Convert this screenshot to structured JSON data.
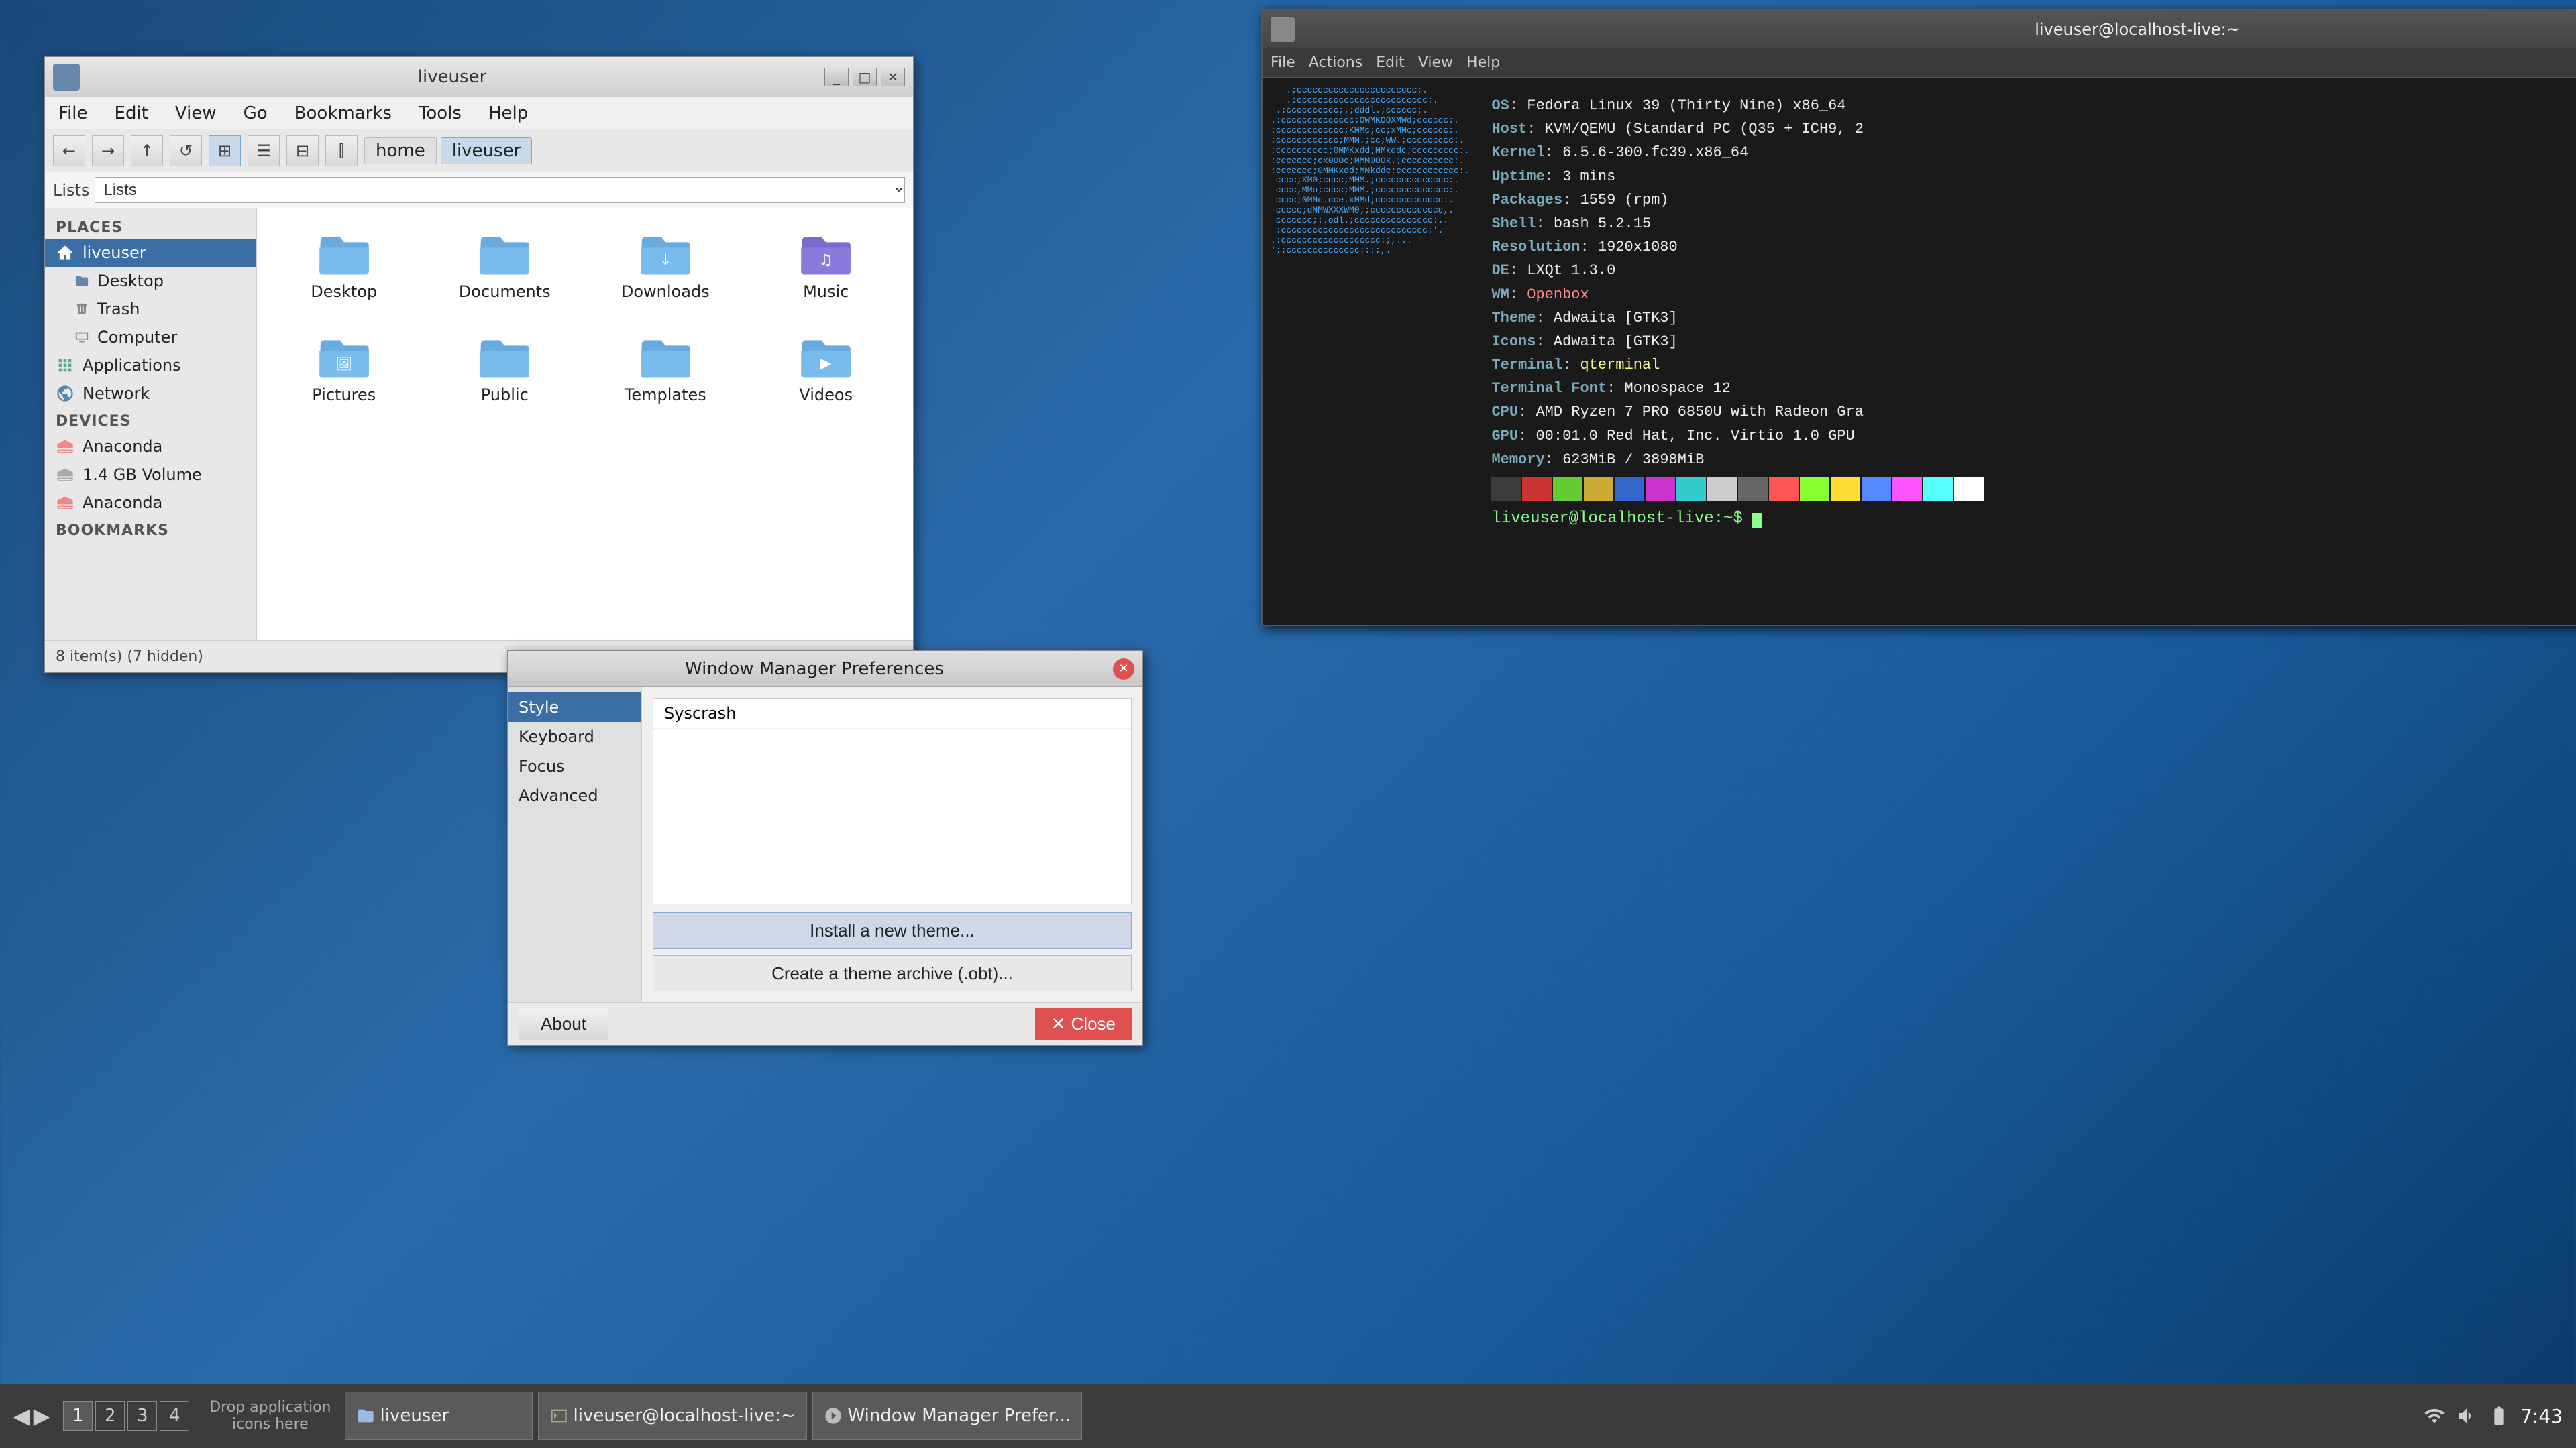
{
  "desktop": {
    "background": "blue-gradient"
  },
  "taskbar": {
    "arrows": "◀ ▶",
    "workspaces": [
      "1",
      "2",
      "3",
      "4"
    ],
    "active_workspace": 0,
    "drop_label": "Drop application\nicons here",
    "windows": [
      {
        "label": "liveuser",
        "icon": "folder",
        "active": false
      },
      {
        "label": "liveuser@localhost-live:~",
        "icon": "terminal",
        "active": false
      },
      {
        "label": "Window Manager Prefer...",
        "icon": "settings",
        "active": false
      }
    ],
    "tray_icons": [
      "network",
      "speaker",
      "battery",
      "clock"
    ],
    "time": "7:43"
  },
  "file_manager": {
    "title": "liveuser",
    "menubar": [
      "File",
      "Edit",
      "View",
      "Go",
      "Bookmarks",
      "Tools",
      "Help"
    ],
    "toolbar": {
      "back": "←",
      "forward": "→",
      "up": "↑",
      "reload": "↺",
      "view_icons": "⊞",
      "view_list": "≡",
      "view_compact": "⊟",
      "view_columns": "⫿",
      "breadcrumbs": [
        "home",
        "liveuser"
      ]
    },
    "sidebar": {
      "lists_label": "Lists",
      "sections": [
        {
          "name": "Places",
          "items": [
            {
              "label": "liveuser",
              "type": "folder",
              "active": true
            },
            {
              "label": "Desktop",
              "type": "folder",
              "indent": true
            },
            {
              "label": "Trash",
              "type": "trash",
              "indent": true
            },
            {
              "label": "Computer",
              "type": "computer",
              "indent": true
            },
            {
              "label": "Applications",
              "type": "apps"
            },
            {
              "label": "Network",
              "type": "network"
            }
          ]
        },
        {
          "name": "Devices",
          "items": [
            {
              "label": "Anaconda",
              "type": "drive"
            },
            {
              "label": "1.4 GB Volume",
              "type": "drive"
            },
            {
              "label": "Anaconda",
              "type": "drive"
            }
          ]
        },
        {
          "name": "Bookmarks",
          "items": []
        }
      ]
    },
    "files": [
      {
        "name": "Desktop",
        "type": "folder"
      },
      {
        "name": "Documents",
        "type": "folder"
      },
      {
        "name": "Downloads",
        "type": "folder"
      },
      {
        "name": "Music",
        "type": "folder-music"
      },
      {
        "name": "Pictures",
        "type": "folder-pictures"
      },
      {
        "name": "Public",
        "type": "folder"
      },
      {
        "name": "Templates",
        "type": "folder"
      },
      {
        "name": "Videos",
        "type": "folder-video"
      }
    ],
    "status": {
      "item_count": "8 item(s) (7 hidden)",
      "free_space": "Free space: 1.1 GiB (Total: 4.8 GiB)"
    }
  },
  "terminal": {
    "title": "liveuser@localhost-live:~",
    "menubar": [
      "File",
      "Actions",
      "Edit",
      "View",
      "Help"
    ],
    "ascii_art": "   .;ccccccccccccccccccccccc;.\n   .:ccccccccccccccccccccccccc:.\n .:cccccccccc;.;dddl.;cccccc:.\n.:cccccccccccccc;OWMKOOXMWd;cccccc:.\n:ccccccccccccc;KMMc;cc;xMMc;cccccc:.\n:cccccccccccc;MMM.;cc;WW.;cccccccc:.\n:cccccccccc;MMM.;cccccccccccc:.\n:ccccccc;ox0OOo;MMM0OOk.;ccccccccccc:.\n:ccccccc;0MMKxdd;MMkddc;ccccccccccc:.\n cccc;XM0;cccc;MMM.;cccccccccccc:.\n cccc;MMo;cccc;MMM.;cccccccccccc:.\n cccc;0MNc.cce.xMMd;ccccccccccc:.\n ccccc;dNMWXXXWM0;;ccccccccccc,.\n ccccccc;:.odl.;ccccccccccccccc:.\n :cccccccccccccccccccccccccccc:'.\n.:ccccccccccccccccccc:;,...\n'::cccccccccccccc:::;,.",
    "sysinfo": {
      "OS": "Fedora Linux 39 (Thirty Nine) x86_64",
      "Host": "KVM/QEMU (Standard PC (Q35 + ICH9, 2",
      "Kernel": "6.5.6-300.fc39.x86_64",
      "Uptime": "3 mins",
      "Packages": "1559 (rpm)",
      "Shell": "bash 5.2.15",
      "Resolution": "1920x1080",
      "DE": "LXQt 1.3.0",
      "WM": "Openbox",
      "Theme": "Adwaita [GTK3]",
      "Icons": "Adwaita [GTK3]",
      "Terminal": "qterminal",
      "Terminal Font": "Monospace 12",
      "CPU": "AMD Ryzen 7 PRO 6850U with Radeon Gra",
      "GPU": "00:01.0 Red Hat, Inc. Virtio 1.0 GPU",
      "Memory": "623MiB / 3898MiB"
    },
    "palette_colors": [
      "#3c3c3c",
      "#cc3333",
      "#66cc33",
      "#ccaa33",
      "#3366cc",
      "#cc33cc",
      "#33cccc",
      "#cccccc",
      "#666666",
      "#ff5555",
      "#88ff33",
      "#ffdd33",
      "#5588ff",
      "#ff55ff",
      "#55ffff",
      "#ffffff"
    ],
    "prompt": "liveuser@localhost-live:~$ "
  },
  "theme_dialog": {
    "title": "Window Manager Preferences",
    "sidebar_items": [
      "Style",
      "Keyboard",
      "Focus",
      "Advanced"
    ],
    "active_sidebar": "Style",
    "theme_items": [
      "Syscrash"
    ],
    "buttons": {
      "install": "Install a new theme...",
      "create": "Create a theme archive (.obt)..."
    },
    "footer": {
      "about": "About",
      "close": "Close"
    }
  }
}
